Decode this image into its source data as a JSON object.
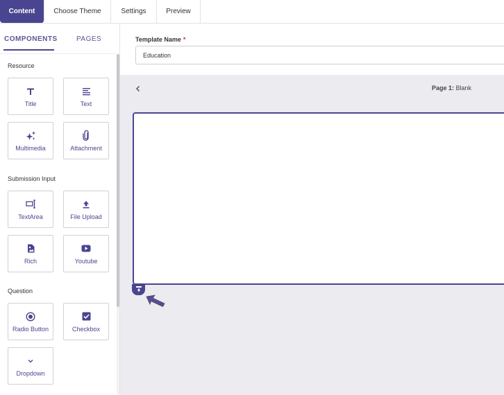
{
  "top_tabs": [
    {
      "label": "Content",
      "active": true
    },
    {
      "label": "Choose Theme",
      "active": false
    },
    {
      "label": "Settings",
      "active": false
    },
    {
      "label": "Preview",
      "active": false
    }
  ],
  "sidebar": {
    "tabs": [
      {
        "label": "COMPONENTS",
        "active": true
      },
      {
        "label": "PAGES",
        "active": false
      }
    ],
    "sections": [
      {
        "title": "Resource",
        "items": [
          {
            "label": "Title",
            "icon": "title-T-icon"
          },
          {
            "label": "Text",
            "icon": "text-lines-icon"
          },
          {
            "label": "Multimedia",
            "icon": "sparkles-icon"
          },
          {
            "label": "Attachment",
            "icon": "paperclip-icon"
          }
        ]
      },
      {
        "title": "Submission Input",
        "items": [
          {
            "label": "TextArea",
            "icon": "textarea-cursor-icon"
          },
          {
            "label": "File Upload",
            "icon": "upload-icon"
          },
          {
            "label": "Rich",
            "icon": "rich-image-file-icon"
          },
          {
            "label": "Youtube",
            "icon": "youtube-icon"
          }
        ]
      },
      {
        "title": "Question",
        "items": [
          {
            "label": "Radio Button",
            "icon": "radio-icon"
          },
          {
            "label": "Checkbox",
            "icon": "checkbox-icon"
          },
          {
            "label": "Dropdown",
            "icon": "chevron-down-icon"
          }
        ]
      }
    ]
  },
  "main": {
    "template_name_label": "Template Name",
    "required_mark": "*",
    "template_name_value": "Education",
    "page_indicator_prefix": "Page 1:",
    "page_indicator_name": "Blank"
  },
  "colors": {
    "accent": "#4a4590",
    "canvas_bg": "#ebebf0",
    "required": "#c0392b"
  }
}
